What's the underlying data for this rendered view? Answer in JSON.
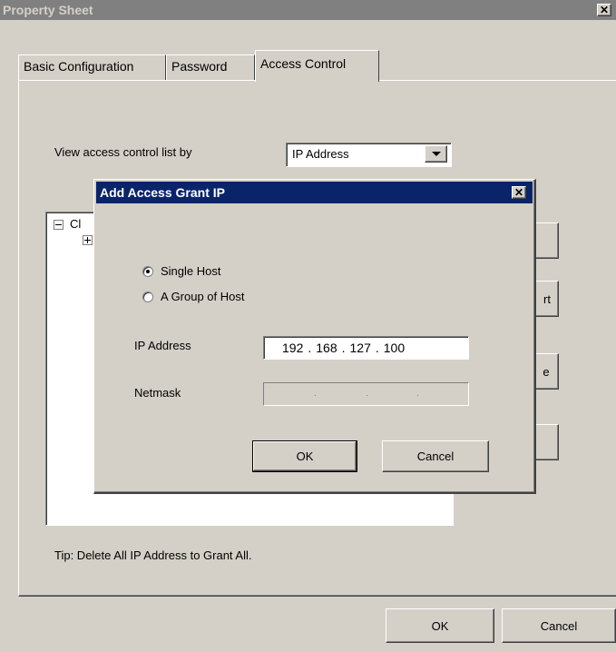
{
  "window": {
    "title": "Property Sheet",
    "close_glyph": "✕"
  },
  "tabs": [
    {
      "label": "Basic Configuration"
    },
    {
      "label": "Password"
    },
    {
      "label": "Access Control",
      "active": true
    }
  ],
  "access": {
    "view_label": "View access control list by",
    "view_select": "IP Address",
    "tree_root_prefix": "Cl",
    "side_buttons": [
      "",
      "rt",
      "e",
      ""
    ],
    "tip": "Tip: Delete All IP Address to Grant All."
  },
  "footer": {
    "ok_label": "OK",
    "cancel_label": "Cancel"
  },
  "dialog": {
    "title": "Add Access Grant IP",
    "single_host_label": "Single Host",
    "group_host_label": "A Group of Host",
    "selected": "single",
    "ip_label": "IP Address",
    "ip": [
      "192",
      "168",
      "127",
      "100"
    ],
    "netmask_label": "Netmask",
    "ok_label": "OK",
    "cancel_label": "Cancel"
  }
}
